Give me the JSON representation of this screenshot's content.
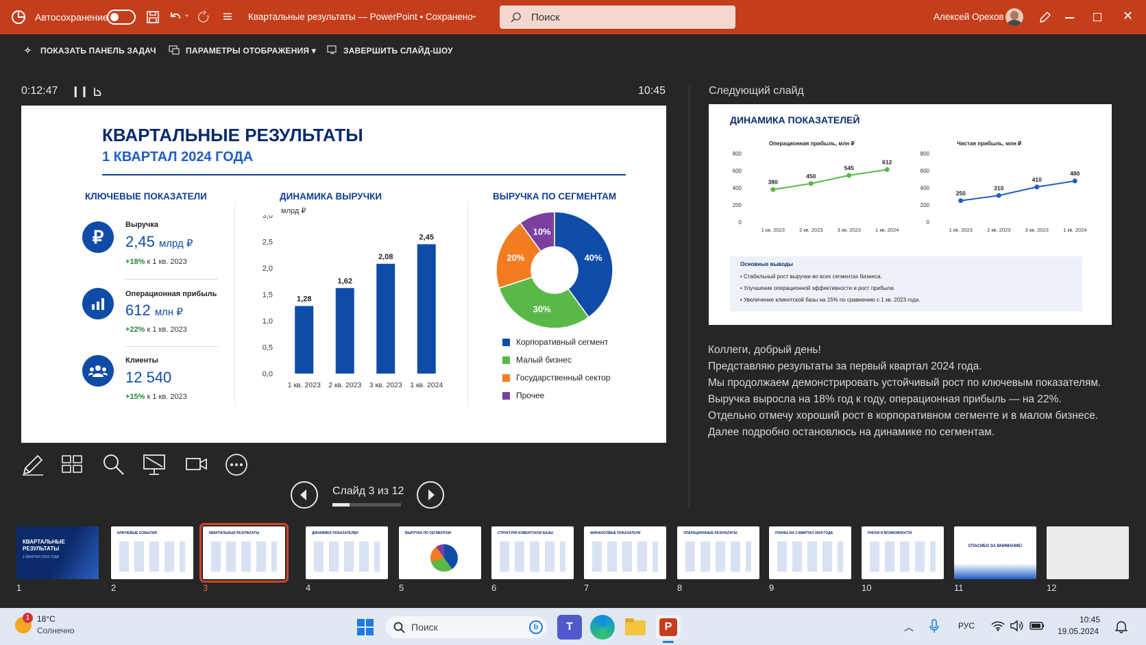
{
  "titlebar": {
    "autosave_label": "Автосохранение",
    "doc_title": "Квартальные результаты — PowerPoint • Сохранено",
    "search_placeholder": "Поиск",
    "user_name": "Алексей Орехов",
    "accent": "#c43e1c"
  },
  "toolbar": {
    "show_taskbar": "ПОКАЗАТЬ ПАНЕЛЬ ЗАДАЧ",
    "display_settings": "ПАРАМЕТРЫ ОТОБРАЖЕНИЯ ▾",
    "end_show": "ЗАВЕРШИТЬ СЛАЙД-ШОУ"
  },
  "presenter": {
    "timer": "0:12:47",
    "clock": "10:45",
    "next_slide_label": "Следующий слайд",
    "slide_counter": "Слайд 3 из 12",
    "slide_progress": 0.25
  },
  "slide": {
    "title": "КВАРТАЛЬНЫЕ РЕЗУЛЬТАТЫ",
    "subtitle": "1 КВАРТАЛ 2024 ГОДА",
    "kpi_header": "КЛЮЧЕВЫЕ ПОКАЗАТЕЛИ",
    "kpis": [
      {
        "icon": "ruble-icon",
        "label": "Выручка",
        "value": "2,45",
        "unit": "млрд ₽",
        "change": "+18%",
        "change_ref": "к 1 кв. 2023"
      },
      {
        "icon": "bar-chart-icon",
        "label": "Операционная прибыль",
        "value": "612",
        "unit": "млн ₽",
        "change": "+22%",
        "change_ref": "к 1 кв. 2023"
      },
      {
        "icon": "users-icon",
        "label": "Клиенты",
        "value": "12 540",
        "unit": "",
        "change": "+15%",
        "change_ref": "к 1 кв. 2023"
      }
    ],
    "revenue_header": "ДИНАМИКА ВЫРУЧКИ",
    "revenue_unit": "млрд ₽",
    "segments_header": "ВЫРУЧКА ПО СЕГМЕНТАМ"
  },
  "chart_data": [
    {
      "type": "bar",
      "title": "ДИНАМИКА ВЫРУЧКИ",
      "ylabel": "млрд ₽",
      "categories": [
        "1 кв. 2023",
        "2 кв. 2023",
        "3 кв. 2023",
        "1 кв. 2024"
      ],
      "values": [
        1.28,
        1.62,
        2.08,
        2.45
      ],
      "value_labels": [
        "1,28",
        "1,62",
        "2,08",
        "2,45"
      ],
      "yticks": [
        "0,0",
        "0,5",
        "1,0",
        "1,5",
        "2,0",
        "2,5",
        "3,0"
      ],
      "ylim": [
        0,
        3
      ],
      "color": "#0f4ca8"
    },
    {
      "type": "pie",
      "title": "ВЫРУЧКА ПО СЕГМЕНТАМ",
      "donut": true,
      "slices": [
        {
          "name": "Корпоративный сегмент",
          "value": 40,
          "label": "40%",
          "color": "#0f4ca8"
        },
        {
          "name": "Малый бизнес",
          "value": 30,
          "label": "30%",
          "color": "#58b947"
        },
        {
          "name": "Государственный сектор",
          "value": 20,
          "label": "20%",
          "color": "#f47c20"
        },
        {
          "name": "Прочее",
          "value": 10,
          "label": "10%",
          "color": "#7b3fa0"
        }
      ]
    },
    {
      "type": "line",
      "title": "Операционная прибыль, млн ₽",
      "categories": [
        "1 кв. 2023",
        "2 кв. 2023",
        "3 кв. 2023",
        "1 кв. 2024"
      ],
      "values": [
        380,
        450,
        545,
        612
      ],
      "yticks": [
        "0",
        "200",
        "400",
        "600",
        "800"
      ],
      "ylim": [
        0,
        800
      ],
      "color": "#58b947"
    },
    {
      "type": "line",
      "title": "Чистая прибыль, млн ₽",
      "categories": [
        "1 кв. 2023",
        "2 кв. 2023",
        "3 кв. 2023",
        "1 кв. 2024"
      ],
      "values": [
        250,
        310,
        410,
        480
      ],
      "yticks": [
        "0",
        "200",
        "400",
        "600",
        "800"
      ],
      "ylim": [
        0,
        800
      ],
      "color": "#1f5fc4"
    }
  ],
  "next_slide": {
    "title": "ДИНАМИКА ПОКАЗАТЕЛЕЙ",
    "conclusions_title": "Основные выводы",
    "conclusions": [
      "Стабильный рост выручки во всех сегментах бизнеса.",
      "Улучшение операционной эффективности и рост прибыли.",
      "Увеличение клиентской базы на 15% по сравнению с 1 кв. 2023 года."
    ]
  },
  "notes": [
    "Коллеги, добрый день!",
    "Представляю результаты за первый квартал 2024 года.",
    "Мы продолжаем демонстрировать устойчивый рост по ключевым показателям. Выручка выросла на 18% год к году, операционная прибыль — на 22%.",
    "Отдельно отмечу хороший рост в корпоративном сегменте и в малом бизнесе.",
    "Далее подробно остановлюсь на динамике по сегментам."
  ],
  "thumbnails": [
    {
      "num": "1",
      "title": "КВАРТАЛЬНЫЕ РЕЗУЛЬТАТЫ",
      "sub": "1 КВАРТАЛ 2024 ГОДА"
    },
    {
      "num": "2",
      "title": "КЛЮЧЕВЫЕ СОБЫТИЯ"
    },
    {
      "num": "3",
      "title": "КВАРТАЛЬНЫЕ РЕЗУЛЬТАТЫ",
      "active": true
    },
    {
      "num": "4",
      "title": "ДИНАМИКА ПОКАЗАТЕЛЕЙ"
    },
    {
      "num": "5",
      "title": "ВЫРУЧКА ПО СЕГМЕНТАМ"
    },
    {
      "num": "6",
      "title": "СТРУКТУРА КЛИЕНТСКОЙ БАЗЫ"
    },
    {
      "num": "7",
      "title": "ФИНАНСОВЫЕ ПОКАЗАТЕЛИ"
    },
    {
      "num": "8",
      "title": "ОПЕРАЦИОННЫЕ РЕЗУЛЬТАТЫ"
    },
    {
      "num": "9",
      "title": "ПЛАНЫ НА 2 КВАРТАЛ 2024 ГОДА"
    },
    {
      "num": "10",
      "title": "РИСКИ И ВОЗМОЖНОСТИ"
    },
    {
      "num": "11",
      "title": "СПАСИБО ЗА ВНИМАНИЕ!"
    },
    {
      "num": "12",
      "title": ""
    }
  ],
  "taskbar": {
    "weather_temp": "18°C",
    "weather_desc": "Солнечно",
    "weather_badge": "1",
    "search_placeholder": "Поиск",
    "lang": "РУС",
    "time": "10:45",
    "date": "19.05.2024"
  }
}
